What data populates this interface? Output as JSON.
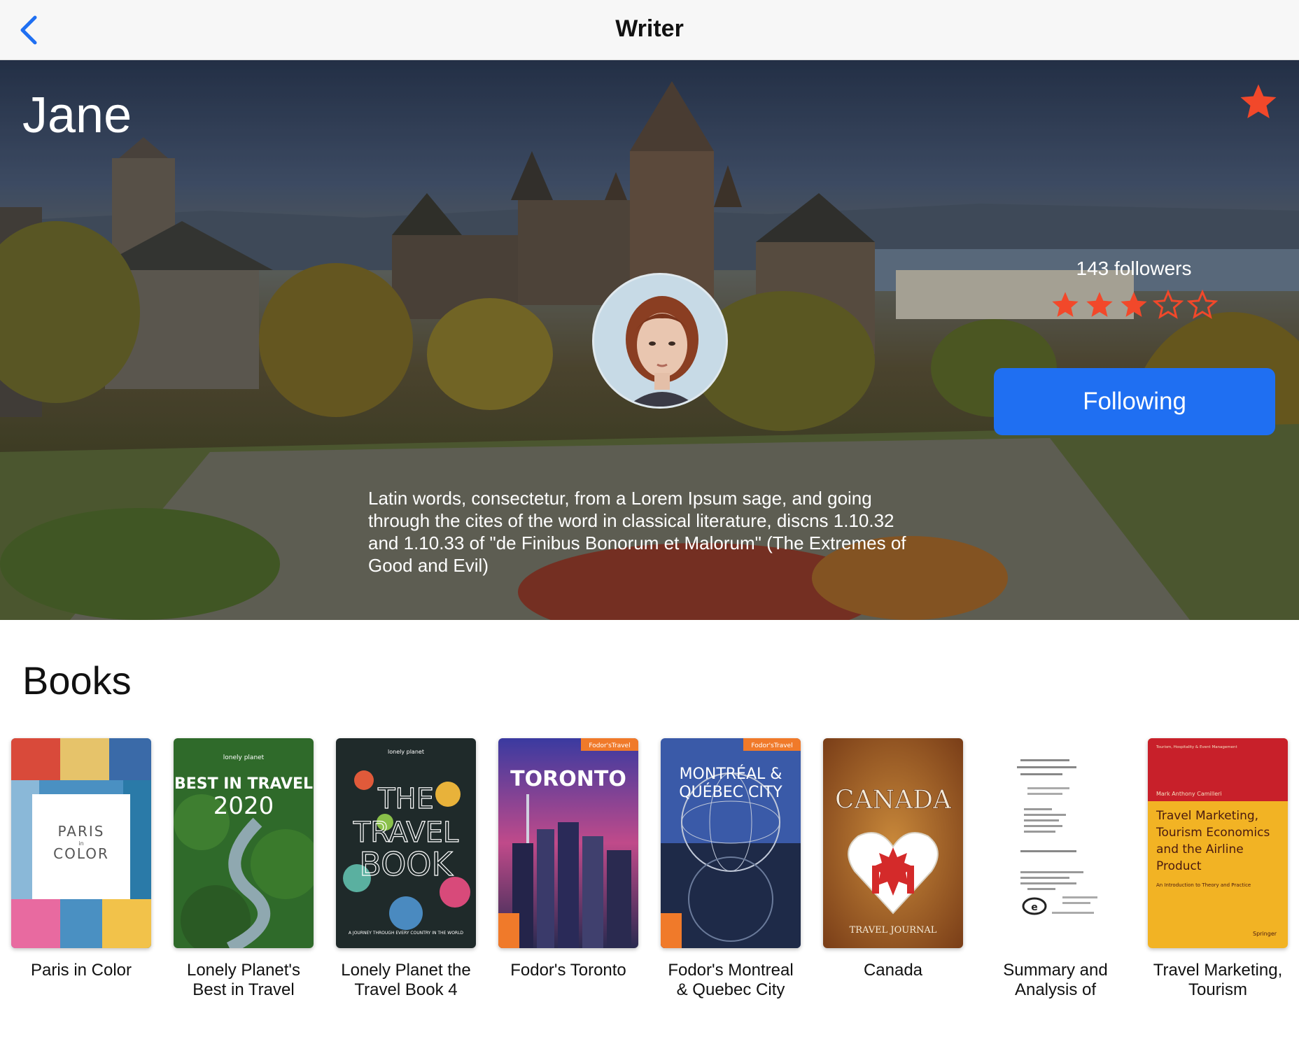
{
  "nav": {
    "title": "Writer",
    "back_icon": "chevron-left-icon"
  },
  "colors": {
    "accent": "#1f6ff2",
    "favorite": "#f2482a"
  },
  "writer": {
    "name": "Jane",
    "followers": "143 followers",
    "rating": 3,
    "rating_max": 5,
    "follow_label": "Following",
    "bio": "Latin words, consectetur, from a Lorem Ipsum sage, and going through the cites of the word in classical literature, discns 1.10.32 and 1.10.33 of \"de Finibus Bonorum et Malorum\" (The Extremes of Good and Evil)"
  },
  "books_section": {
    "title": "Books",
    "items": [
      {
        "title": "Paris in Color",
        "cover": {
          "line1": "PARIS",
          "line2": "in",
          "line3": "COLOR"
        }
      },
      {
        "title": "Lonely Planet's Best in Travel",
        "cover": {
          "brand": "lonely planet",
          "line1": "BEST IN TRAVEL",
          "line2": "2020"
        }
      },
      {
        "title": "Lonely Planet the Travel Book 4",
        "cover": {
          "brand": "lonely planet",
          "line1": "THE",
          "line2": "TRAVEL",
          "line3": "BOOK",
          "line4": "A JOURNEY THROUGH EVERY COUNTRY IN THE WORLD"
        }
      },
      {
        "title": "Fodor's Toronto",
        "cover": {
          "brand": "Fodor'sTravel",
          "line1": "TORONTO"
        }
      },
      {
        "title": "Fodor's Montreal & Quebec City",
        "cover": {
          "brand": "Fodor'sTravel",
          "line1": "MONTRÉAL &",
          "line2": "QUÉBEC CITY"
        }
      },
      {
        "title": "Canada",
        "cover": {
          "line1": "CANADA",
          "line2": "TRAVEL JOURNAL"
        }
      },
      {
        "title": "Summary and Analysis of",
        "cover": {}
      },
      {
        "title": "Travel Marketing, Tourism",
        "cover": {
          "series": "Tourism, Hospitality & Event Management",
          "author": "Mark Anthony Camilleri",
          "line1": "Travel Marketing,",
          "line2": "Tourism Economics",
          "line3": "and the Airline",
          "line4": "Product",
          "line5": "An Introduction to Theory and Practice",
          "publisher": "Springer"
        }
      }
    ]
  }
}
